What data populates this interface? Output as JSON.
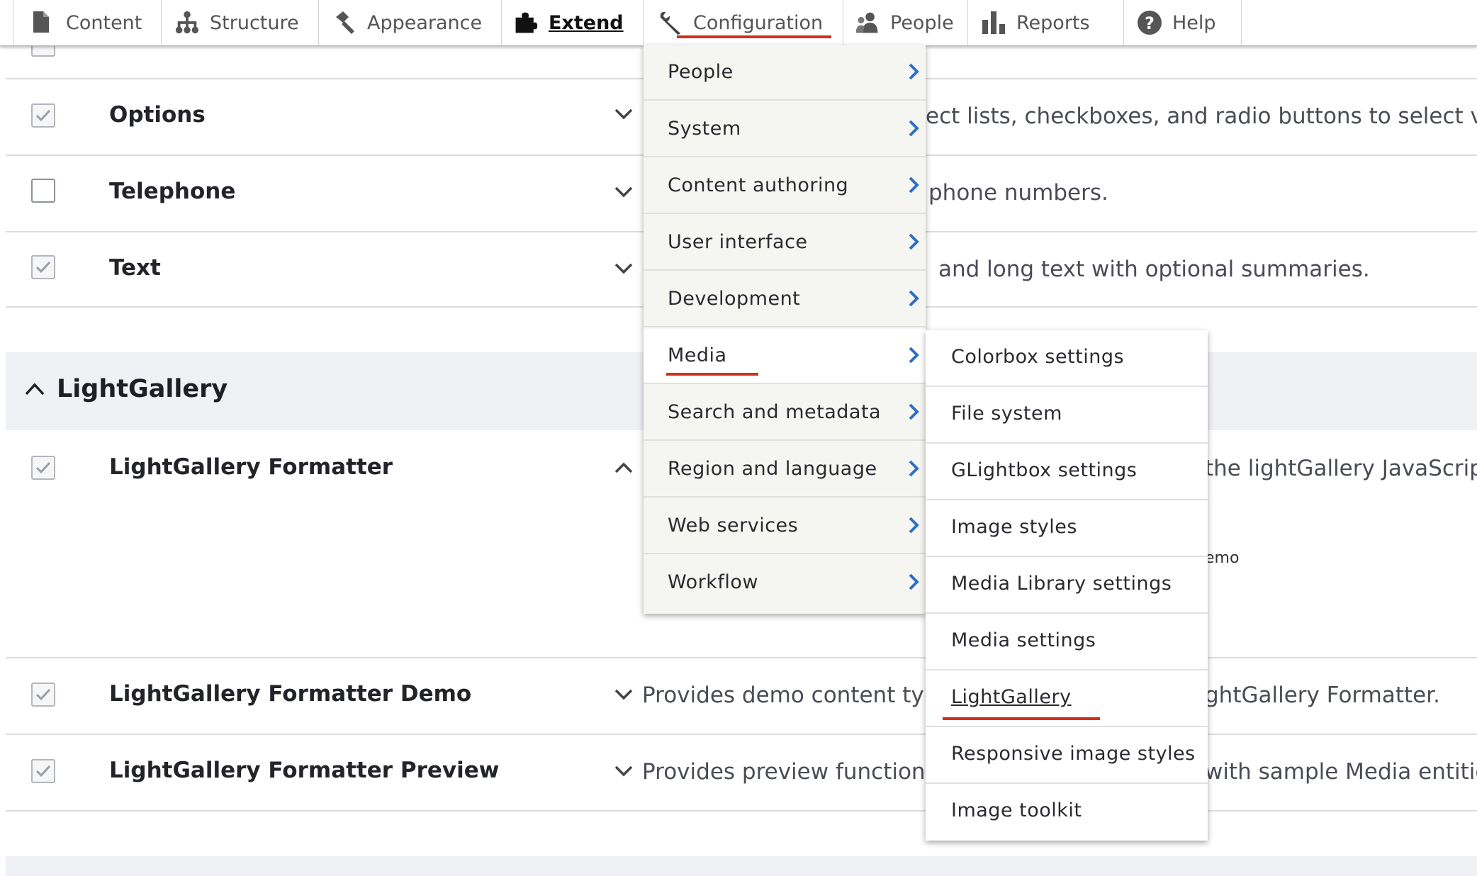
{
  "toolbar": {
    "items": [
      {
        "label": "Content",
        "icon": "file-icon"
      },
      {
        "label": "Structure",
        "icon": "sitemap-icon"
      },
      {
        "label": "Appearance",
        "icon": "paintbrush-icon"
      },
      {
        "label": "Extend",
        "icon": "puzzle-icon"
      },
      {
        "label": "Configuration",
        "icon": "wrench-icon"
      },
      {
        "label": "People",
        "icon": "people-icon"
      },
      {
        "label": "Reports",
        "icon": "bar-chart-icon"
      },
      {
        "label": "Help",
        "icon": "help-icon"
      }
    ],
    "active": "Extend",
    "open": "Configuration"
  },
  "modules": {
    "options": {
      "title": "Options",
      "desc": "ect lists, checkboxes, and radio buttons to select value",
      "checked": true
    },
    "telephone": {
      "title": "Telephone",
      "desc": "phone numbers.",
      "checked": false
    },
    "text": {
      "title": "Text",
      "desc": "and long text with optional summaries.",
      "checked": true
    },
    "group": {
      "title": "LightGallery"
    },
    "formatter": {
      "title": "LightGallery Formatter",
      "desc": "the lightGallery JavaScript",
      "tail": "emo",
      "checked": true
    },
    "demo": {
      "title": "LightGallery Formatter Demo",
      "desc_left": "Provides demo content type",
      "desc_right": "ghtGallery Formatter.",
      "checked": true
    },
    "preview": {
      "title": "LightGallery Formatter Preview",
      "desc_left": "Provides preview functional",
      "desc_right": "with sample Media entities.",
      "checked": true
    }
  },
  "config_menu": {
    "items": [
      "People",
      "System",
      "Content authoring",
      "User interface",
      "Development",
      "Media",
      "Search and metadata",
      "Region and language",
      "Web services",
      "Workflow"
    ],
    "highlighted": "Media"
  },
  "media_menu": {
    "items": [
      "Colorbox settings",
      "File system",
      "GLightbox settings",
      "Image styles",
      "Media Library settings",
      "Media settings",
      "LightGallery",
      "Responsive image styles",
      "Image toolkit"
    ],
    "highlighted": "LightGallery"
  },
  "colors": {
    "accent_underline": "#d0301a",
    "arrow_blue": "#2f6fc4",
    "group_bg": "#f0f1f5"
  }
}
